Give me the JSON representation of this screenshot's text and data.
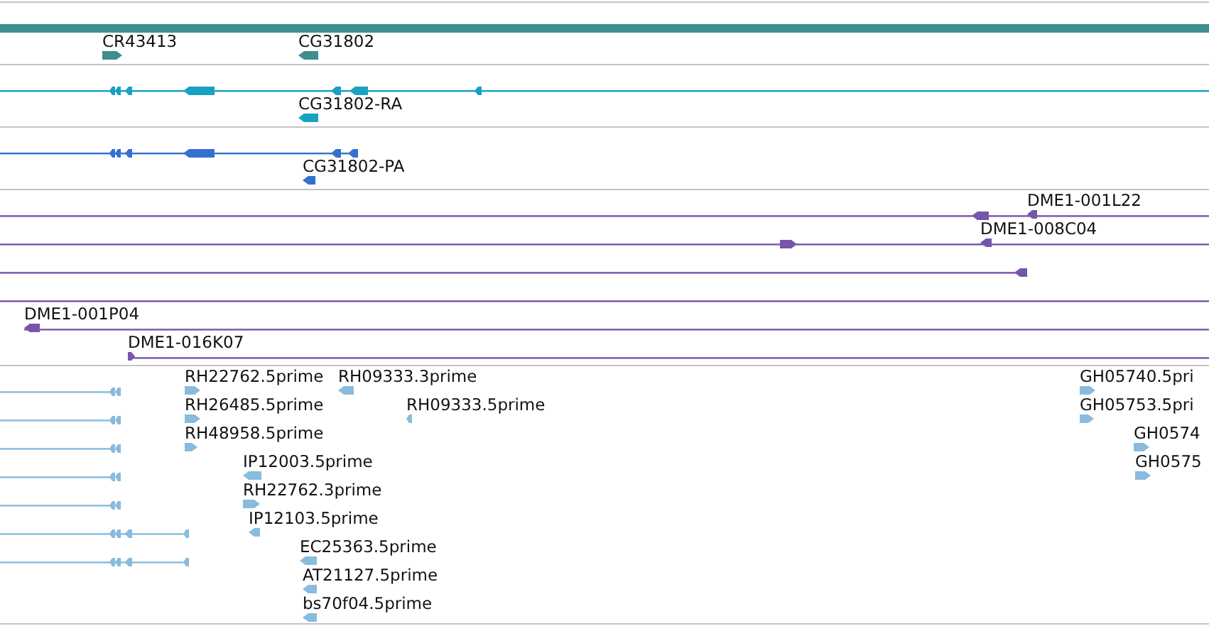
{
  "tracks": [
    {
      "kind": "gene",
      "features": [
        {
          "label": "CR43413",
          "reverse": false
        },
        {
          "label": "CG31802",
          "reverse": true
        }
      ]
    },
    {
      "kind": "transcript",
      "features": [
        {
          "label": "CG31802-RA",
          "reverse": true
        }
      ]
    },
    {
      "kind": "protein",
      "features": [
        {
          "label": "CG31802-PA",
          "reverse": true
        }
      ]
    },
    {
      "kind": "clone",
      "features": [
        {
          "label": "DME1-001L22",
          "reverse": true
        },
        {
          "label": "DME1-008C04",
          "reverse": true
        },
        {
          "label": "DME1-001P04",
          "reverse": true
        },
        {
          "label": "DME1-016K07",
          "reverse": false
        }
      ]
    },
    {
      "kind": "est",
      "features": [
        {
          "label": "RH22762.5prime",
          "reverse": false
        },
        {
          "label": "RH09333.3prime",
          "reverse": true
        },
        {
          "label": "RH26485.5prime",
          "reverse": false
        },
        {
          "label": "RH09333.5prime",
          "reverse": true
        },
        {
          "label": "RH48958.5prime",
          "reverse": false
        },
        {
          "label": "IP12003.5prime",
          "reverse": true
        },
        {
          "label": "RH22762.3prime",
          "reverse": false
        },
        {
          "label": "IP12103.5prime",
          "reverse": true
        },
        {
          "label": "EC25363.5prime",
          "reverse": true
        },
        {
          "label": "AT21127.5prime",
          "reverse": true
        },
        {
          "label": "bs70f04.5prime",
          "reverse": true
        },
        {
          "label": "GH05740.5pri",
          "reverse": false
        },
        {
          "label": "GH05753.5pri",
          "reverse": false
        },
        {
          "label": "GH0574",
          "reverse": false
        },
        {
          "label": "GH0575",
          "reverse": false
        }
      ]
    }
  ]
}
